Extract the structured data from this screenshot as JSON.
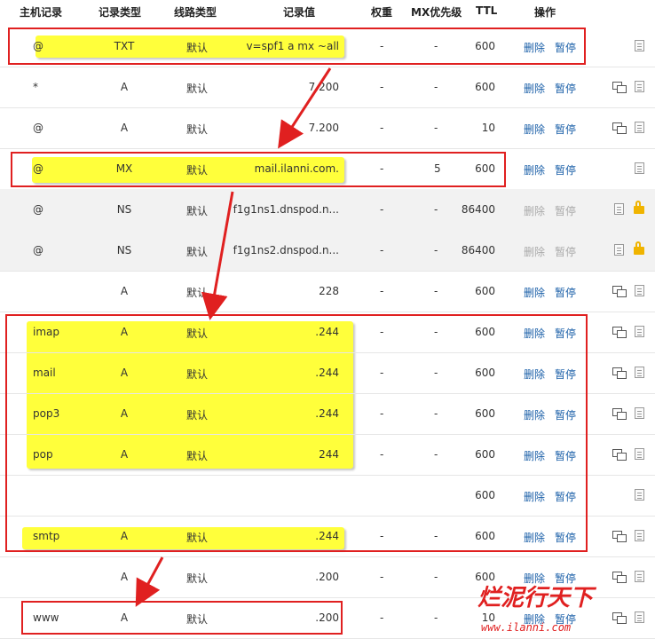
{
  "columns": {
    "host": "主机记录",
    "type": "记录类型",
    "line": "线路类型",
    "value": "记录值",
    "weight": "权重",
    "mx": "MX优先级",
    "ttl": "TTL",
    "actions": "操作"
  },
  "action_labels": {
    "delete": "删除",
    "pause": "暂停"
  },
  "rows": [
    {
      "host": "@",
      "type": "TXT",
      "line": "默认",
      "value": "v=spf1 a mx ~all",
      "weight": "-",
      "mx": "-",
      "ttl": "600",
      "actions_enabled": true,
      "icons": [
        "note-icon"
      ]
    },
    {
      "host": "*",
      "type": "A",
      "line": "默认",
      "value": "7.200",
      "weight": "-",
      "mx": "-",
      "ttl": "600",
      "actions_enabled": true,
      "icons": [
        "monitor-icon",
        "note-icon"
      ]
    },
    {
      "host": "@",
      "type": "A",
      "line": "默认",
      "value": "7.200",
      "weight": "-",
      "mx": "-",
      "ttl": "10",
      "actions_enabled": true,
      "icons": [
        "monitor-icon",
        "note-icon"
      ]
    },
    {
      "host": "@",
      "type": "MX",
      "line": "默认",
      "value": "mail.ilanni.com.",
      "weight": "-",
      "mx": "5",
      "ttl": "600",
      "actions_enabled": true,
      "icons": [
        "note-icon"
      ]
    },
    {
      "host": "@",
      "type": "NS",
      "line": "默认",
      "value": "f1g1ns1.dnspod.n...",
      "weight": "-",
      "mx": "-",
      "ttl": "86400",
      "actions_enabled": false,
      "icons": [
        "note-icon",
        "lock-icon"
      ]
    },
    {
      "host": "@",
      "type": "NS",
      "line": "默认",
      "value": "f1g1ns2.dnspod.n...",
      "weight": "-",
      "mx": "-",
      "ttl": "86400",
      "actions_enabled": false,
      "icons": [
        "note-icon",
        "lock-icon"
      ]
    },
    {
      "host": "",
      "type": "A",
      "line": "默认",
      "value": "228",
      "weight": "-",
      "mx": "-",
      "ttl": "600",
      "actions_enabled": true,
      "icons": [
        "monitor-icon",
        "note-icon"
      ]
    },
    {
      "host": "imap",
      "type": "A",
      "line": "默认",
      "value": ".244",
      "weight": "-",
      "mx": "-",
      "ttl": "600",
      "actions_enabled": true,
      "icons": [
        "monitor-icon",
        "note-icon"
      ]
    },
    {
      "host": "mail",
      "type": "A",
      "line": "默认",
      "value": ".244",
      "weight": "-",
      "mx": "-",
      "ttl": "600",
      "actions_enabled": true,
      "icons": [
        "monitor-icon",
        "note-icon"
      ]
    },
    {
      "host": "pop3",
      "type": "A",
      "line": "默认",
      "value": ".244",
      "weight": "-",
      "mx": "-",
      "ttl": "600",
      "actions_enabled": true,
      "icons": [
        "monitor-icon",
        "note-icon"
      ]
    },
    {
      "host": "pop",
      "type": "A",
      "line": "默认",
      "value": "244",
      "weight": "-",
      "mx": "-",
      "ttl": "600",
      "actions_enabled": true,
      "icons": [
        "monitor-icon",
        "note-icon"
      ]
    },
    {
      "host": "",
      "type": "",
      "line": "",
      "value": "",
      "weight": "",
      "mx": "",
      "ttl": "600",
      "actions_enabled": true,
      "icons": [
        "note-icon"
      ]
    },
    {
      "host": "smtp",
      "type": "A",
      "line": "默认",
      "value": ".244",
      "weight": "-",
      "mx": "-",
      "ttl": "600",
      "actions_enabled": true,
      "icons": [
        "monitor-icon",
        "note-icon"
      ]
    },
    {
      "host": "",
      "type": "A",
      "line": "默认",
      "value": ".200",
      "weight": "-",
      "mx": "-",
      "ttl": "600",
      "actions_enabled": true,
      "icons": [
        "monitor-icon",
        "note-icon"
      ]
    },
    {
      "host": "www",
      "type": "A",
      "line": "默认",
      "value": ".200",
      "weight": "-",
      "mx": "-",
      "ttl": "10",
      "actions_enabled": true,
      "icons": [
        "monitor-icon",
        "note-icon"
      ]
    }
  ],
  "watermark": {
    "title": "烂泥行天下",
    "url": "www.ilanni.com"
  },
  "colors": {
    "highlight": "#ffff3b",
    "annotation": "#e02020",
    "link": "#1a5fa8",
    "disabled": "#aaaaaa"
  }
}
